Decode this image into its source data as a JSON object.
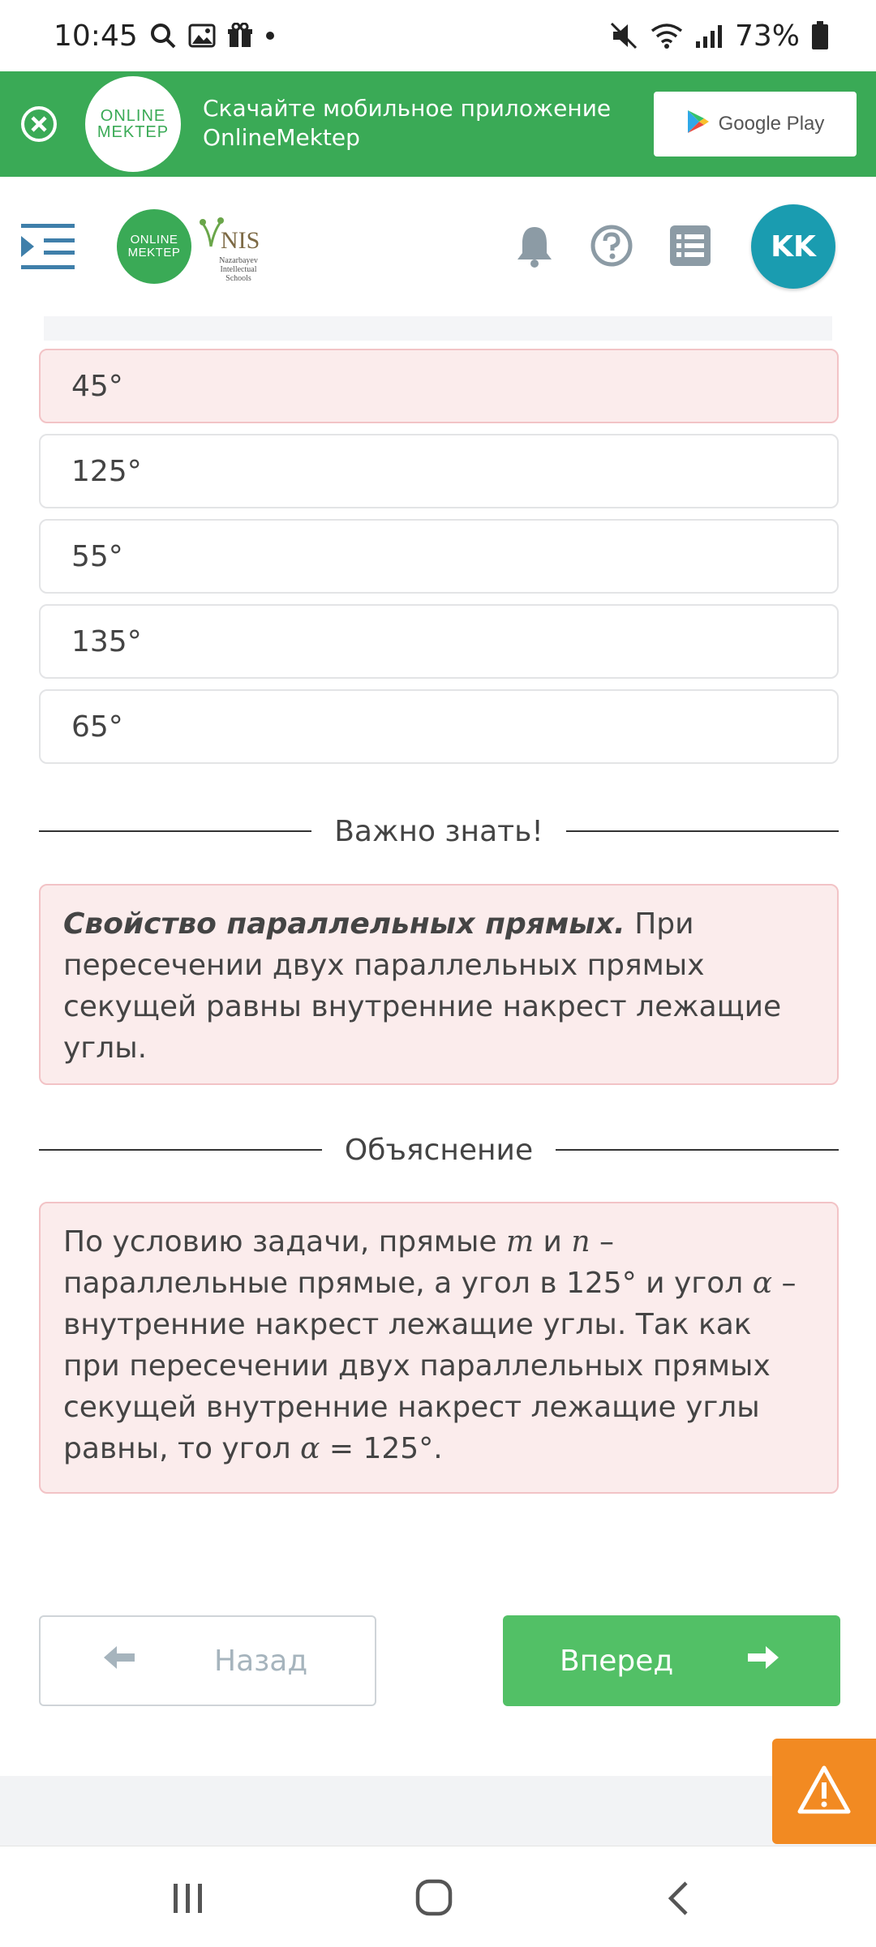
{
  "status_bar": {
    "time": "10:45",
    "battery": "73%"
  },
  "banner": {
    "logo_line1": "ONLINE",
    "logo_line2": "MEKTEP",
    "line1": "Скачайте мобильное приложение",
    "line2": "OnlineMektep",
    "store_button": "Google Play"
  },
  "header": {
    "logo_line1": "ONLINE",
    "logo_line2": "MEKTEP",
    "nis_title": "NIS",
    "nis_subtitle": "Nazarbayev Intellectual Schools",
    "avatar_initials": "KK"
  },
  "options": [
    "45°",
    "125°",
    "55°",
    "135°",
    "65°"
  ],
  "selected_wrong_option": "45°",
  "important": {
    "heading": "Важно знать!",
    "bold": "Свойство параллельных прямых.",
    "text": " При пересечении двух параллельных прямых секущей равны внутренние накрест лежащие углы."
  },
  "explanation": {
    "heading": "Объяснение",
    "p1": "По условию задачи, прямые ",
    "var_m": "m",
    "p2": " и ",
    "var_n": "n",
    "p3": " – параллельные прямые, а угол в 125° и угол ",
    "var_alpha1": "α",
    "p4": " – внутренние накрест лежащие углы. Так как при пересечении двух параллельных прямых секущей внутренние накрест лежащие углы равны, то угол ",
    "var_alpha2": "α",
    "p5": " = 125°."
  },
  "buttons": {
    "back": "Назад",
    "next": "Вперед"
  },
  "colors": {
    "brand_green": "#3aaa56",
    "next_button": "#52c066",
    "wrong_bg": "#fbecec",
    "wrong_border": "#f2c3c6",
    "avatar": "#1a9cb0",
    "warning": "#f28a22"
  }
}
